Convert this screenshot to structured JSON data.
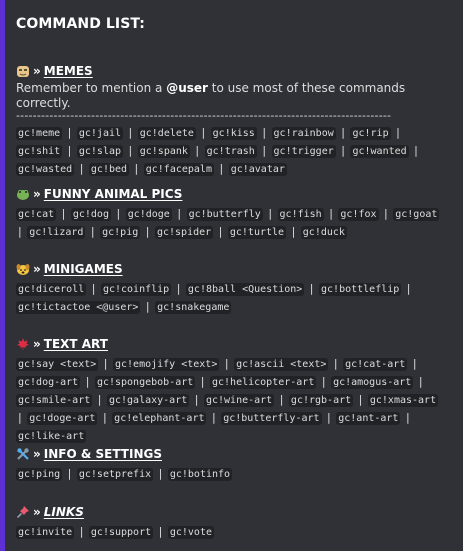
{
  "title": "COMMAND LIST:",
  "sections": [
    {
      "name": "MEMES",
      "desc_pre": "Remember to mention a ",
      "desc_user": "@user",
      "desc_post": " to use most of these commands correctly.",
      "dashes": "------------------------------------------------------------------------------------------",
      "commands": [
        "gc!meme",
        "gc!jail",
        "gc!delete",
        "gc!kiss",
        "gc!rainbow",
        "gc!rip",
        "gc!shit",
        "gc!slap",
        "gc!spank",
        "gc!trash",
        "gc!trigger",
        "gc!wanted",
        "gc!wasted",
        "gc!bed",
        "gc!facepalm",
        "gc!avatar"
      ]
    },
    {
      "name": "FUNNY ANIMAL PICS",
      "commands": [
        "gc!cat",
        "gc!dog",
        "gc!doge",
        "gc!butterfly",
        "gc!fish",
        "gc!fox",
        "gc!goat",
        "gc!lizard",
        "gc!pig",
        "gc!spider",
        "gc!turtle",
        "gc!duck"
      ]
    },
    {
      "name": "MINIGAMES",
      "commands": [
        "gc!diceroll",
        "gc!coinflip",
        "gc!8ball <Question>",
        "gc!bottleflip",
        "gc!tictactoe <@user>",
        "gc!snakegame"
      ]
    },
    {
      "name": "TEXT ART",
      "commands": [
        "gc!say <text>",
        "gc!emojify <text>",
        "gc!ascii <text>",
        "gc!cat-art",
        "gc!dog-art",
        "gc!spongebob-art",
        "gc!helicopter-art",
        "gc!amogus-art",
        "gc!smile-art",
        "gc!galaxy-art",
        "gc!wine-art",
        "gc!rgb-art",
        "gc!xmas-art",
        "gc!doge-art",
        "gc!elephant-art",
        "gc!butterfly-art",
        "gc!ant-art",
        "gc!like-art"
      ]
    },
    {
      "name": "INFO & SETTINGS",
      "commands": [
        "gc!ping",
        "gc!setprefix",
        "gc!botinfo"
      ]
    },
    {
      "name": "LINKS",
      "commands": [
        "gc!invite",
        "gc!support",
        "gc!vote"
      ]
    }
  ],
  "icons": [
    "meme-face-icon",
    "frog-icon",
    "dog-face-icon",
    "maple-leaf-icon",
    "tools-icon",
    "pushpin-icon"
  ],
  "colors": {
    "background": "#2f3136",
    "accent_bar": "#5f2fd6",
    "code_bg": "#202225",
    "text": "#dcddde"
  }
}
